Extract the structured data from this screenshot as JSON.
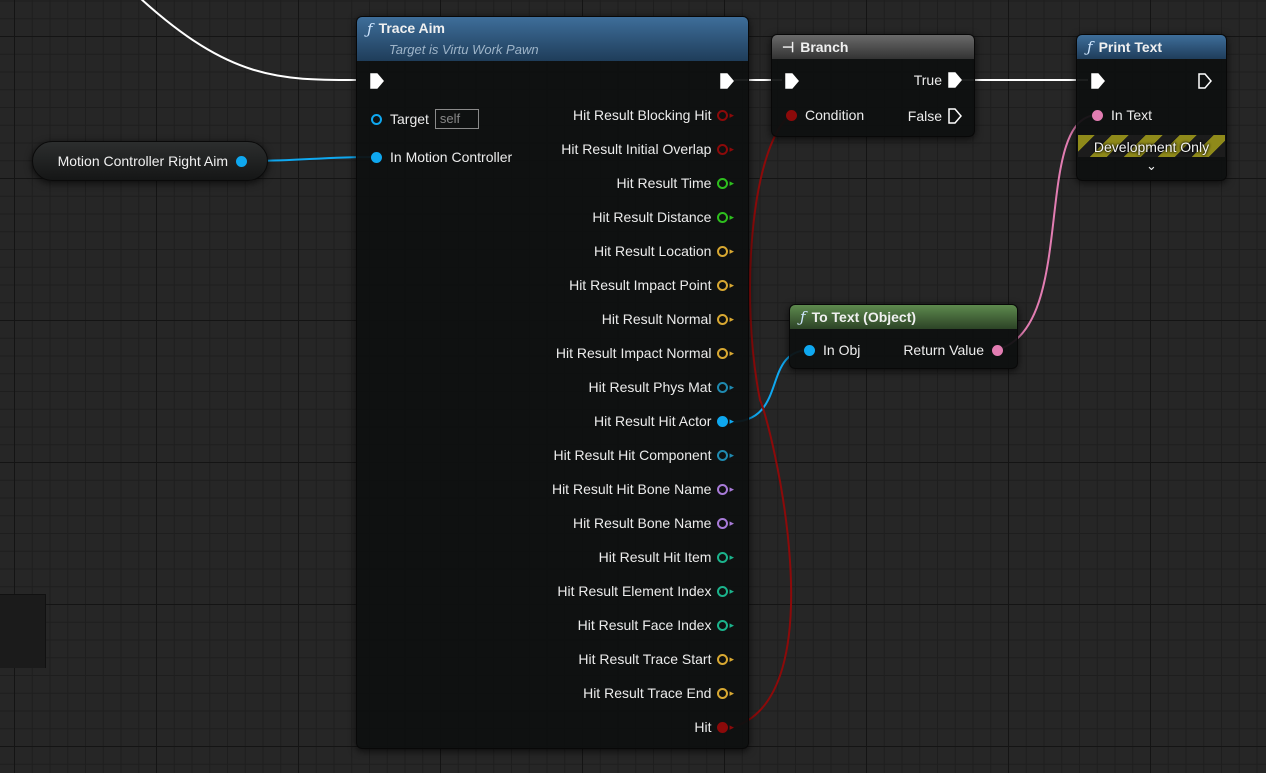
{
  "colors": {
    "exec": "#ffffff",
    "object": "#0fa8f0",
    "bool": "#8c0a0a",
    "float": "#2ebf1e",
    "vector": "#d8a832",
    "struct": "#1f8ab0",
    "name": "#a87bd8",
    "int": "#1bb38c",
    "text": "#e27db2"
  },
  "variable_node": {
    "label": "Motion Controller Right Aim",
    "pin_type": "object"
  },
  "trace_aim": {
    "icon": "function-icon",
    "title": "Trace Aim",
    "subtitle": "Target is Virtu Work Pawn",
    "inputs": [
      {
        "label": "Target",
        "pin_type": "object_hollow",
        "default": "self"
      },
      {
        "label": "In Motion Controller",
        "pin_type": "object"
      }
    ],
    "outputs": [
      {
        "label": "Hit Result Blocking Hit",
        "pin_type": "bool"
      },
      {
        "label": "Hit Result Initial Overlap",
        "pin_type": "bool"
      },
      {
        "label": "Hit Result Time",
        "pin_type": "float"
      },
      {
        "label": "Hit Result Distance",
        "pin_type": "float"
      },
      {
        "label": "Hit Result Location",
        "pin_type": "vector"
      },
      {
        "label": "Hit Result Impact Point",
        "pin_type": "vector"
      },
      {
        "label": "Hit Result Normal",
        "pin_type": "vector"
      },
      {
        "label": "Hit Result Impact Normal",
        "pin_type": "vector"
      },
      {
        "label": "Hit Result Phys Mat",
        "pin_type": "struct"
      },
      {
        "label": "Hit Result Hit Actor",
        "pin_type": "object"
      },
      {
        "label": "Hit Result Hit Component",
        "pin_type": "struct"
      },
      {
        "label": "Hit Result Hit Bone Name",
        "pin_type": "name"
      },
      {
        "label": "Hit Result Bone Name",
        "pin_type": "name"
      },
      {
        "label": "Hit Result Hit Item",
        "pin_type": "int"
      },
      {
        "label": "Hit Result Element Index",
        "pin_type": "int"
      },
      {
        "label": "Hit Result Face Index",
        "pin_type": "int"
      },
      {
        "label": "Hit Result Trace Start",
        "pin_type": "vector"
      },
      {
        "label": "Hit Result Trace End",
        "pin_type": "vector"
      },
      {
        "label": "Hit",
        "pin_type": "bool_filled"
      }
    ]
  },
  "branch": {
    "icon": "branch-icon",
    "title": "Branch",
    "condition_label": "Condition",
    "true_label": "True",
    "false_label": "False"
  },
  "print_text": {
    "icon": "function-icon",
    "title": "Print Text",
    "in_text_label": "In Text",
    "dev_only_label": "Development Only"
  },
  "to_text": {
    "icon": "function-icon",
    "title": "To Text (Object)",
    "in_label": "In Obj",
    "out_label": "Return Value"
  }
}
